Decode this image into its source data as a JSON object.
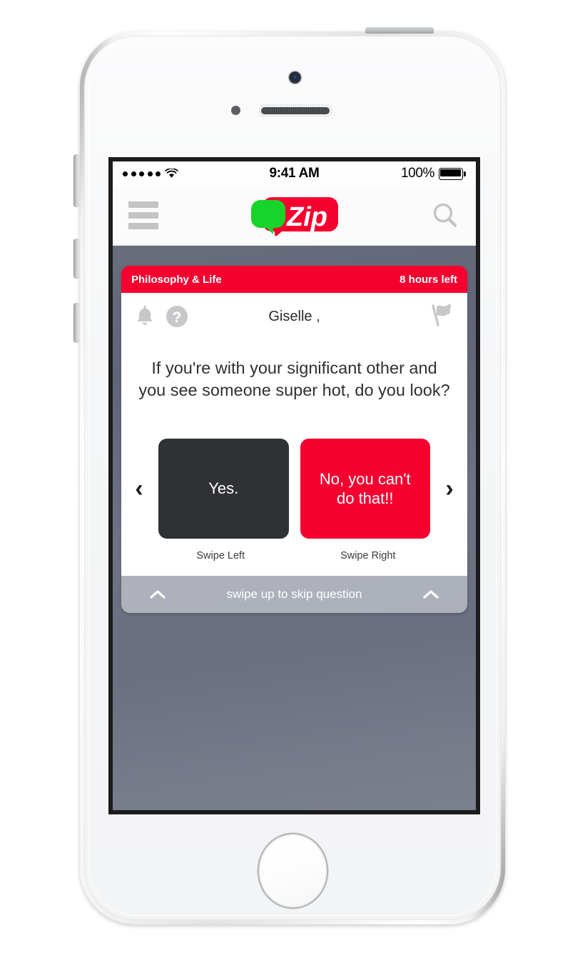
{
  "status_bar": {
    "signal_dots": 5,
    "wifi_icon": "wifi-icon",
    "time": "9:41 AM",
    "battery_percent": "100%",
    "battery_icon": "battery-full-icon"
  },
  "nav_bar": {
    "menu_icon": "hamburger-menu-icon",
    "logo_text": "Zip",
    "logo_trademark": "™",
    "search_icon": "search-icon",
    "logo_colors": {
      "bubble_green": "#17d42a",
      "bubble_red": "#f5002f",
      "wordmark": "#ffffff"
    }
  },
  "card": {
    "category": "Philosophy & Life",
    "time_left": "8 hours left",
    "header_color": "#f5002f",
    "toolbar": {
      "bell_icon": "bell-icon",
      "help_icon": "question-mark-circle-icon",
      "username": "Giselle ,",
      "flag_icon": "flag-icon"
    },
    "question": "If you're with your significant other and you see someone super hot, do you look?",
    "prev_chevron": "‹",
    "next_chevron": "›",
    "answers": [
      {
        "label": "Yes.",
        "hint": "Swipe Left",
        "color": "#2f3134"
      },
      {
        "label": "No, you can't do that!!",
        "hint": "Swipe Right",
        "color": "#f5002f"
      }
    ],
    "skip": {
      "text": "swipe up to skip question",
      "left_chevron_icon": "chevron-up-icon",
      "right_chevron_icon": "chevron-up-icon"
    }
  },
  "device": {
    "camera_icon": "front-camera",
    "sensor_icon": "proximity-sensor",
    "speaker_icon": "earpiece-speaker",
    "home_button": "home-button",
    "power_button": "power-button",
    "mute_switch": "mute-switch",
    "volume_up": "volume-up-button",
    "volume_down": "volume-down-button"
  },
  "theme": {
    "accent_red": "#f5002f",
    "dark": "#2f3134",
    "screen_bg_top": "#676d7a",
    "screen_bg_bottom": "#7b808e"
  }
}
